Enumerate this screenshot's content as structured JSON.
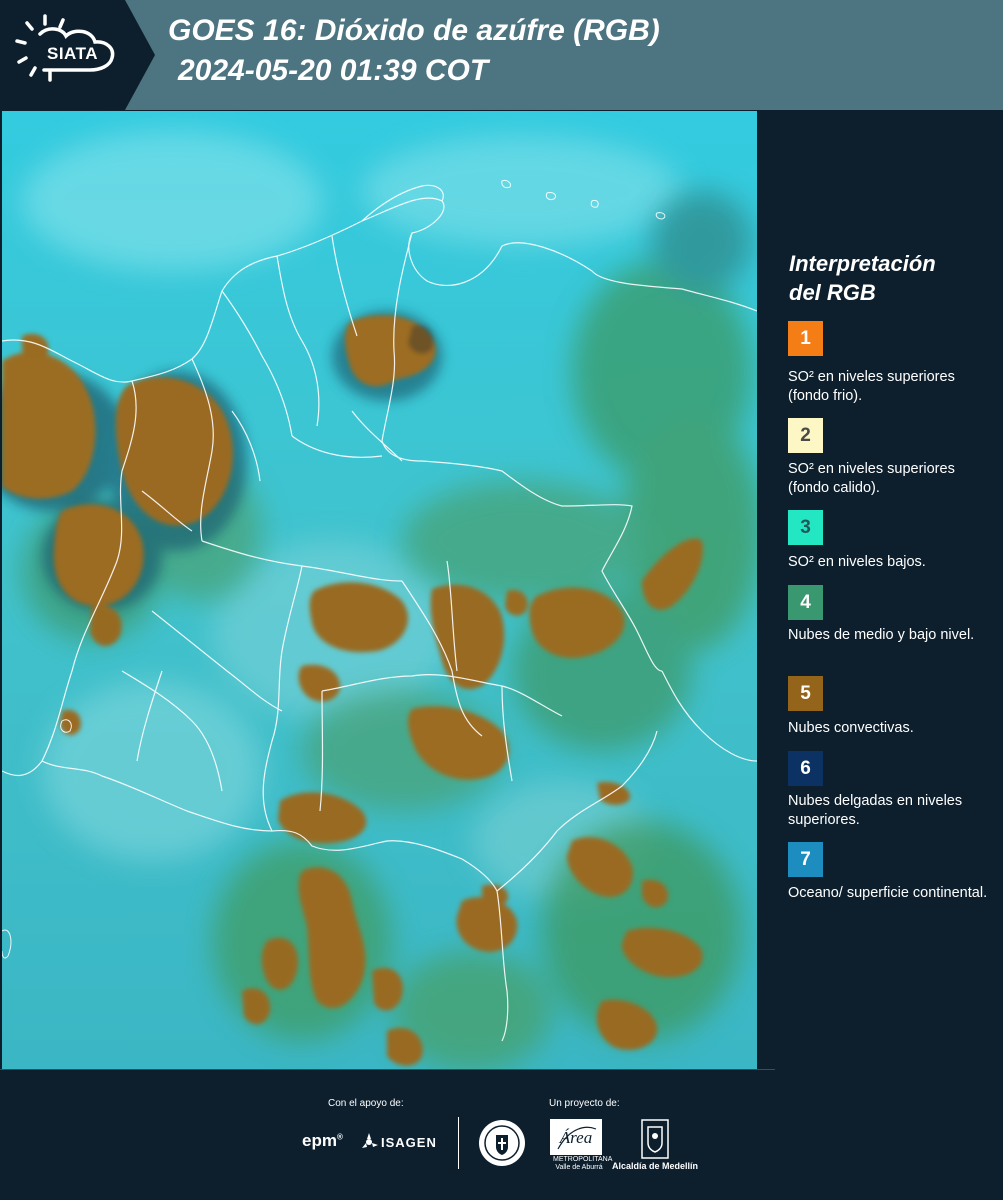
{
  "header": {
    "logo_text": "SIATA",
    "title_line1": "GOES 16: Dióxido de azúfre (RGB)",
    "title_line2": "2024-05-20 01:39 COT"
  },
  "legend": {
    "title_line1": "Interpretación",
    "title_line2": "del RGB",
    "items": [
      {
        "number": "1",
        "color": "#f47d16",
        "text_color": "#ffffff",
        "text": "SO² en niveles superiores (fondo frio)."
      },
      {
        "number": "2",
        "color": "#fdf7c6",
        "text_color": "#4a4a4a",
        "text": "SO² en niveles superiores (fondo calido)."
      },
      {
        "number": "3",
        "color": "#23e6c3",
        "text_color": "#1f5a5a",
        "text": "SO² en niveles bajos."
      },
      {
        "number": "4",
        "color": "#3a9870",
        "text_color": "#ffffff",
        "text": "Nubes de medio y bajo nivel."
      },
      {
        "number": "5",
        "color": "#94641b",
        "text_color": "#ffffff",
        "text": "Nubes convectivas."
      },
      {
        "number": "6",
        "color": "#0c3263",
        "text_color": "#ffffff",
        "text": "Nubes delgadas en niveles superiores."
      },
      {
        "number": "7",
        "color": "#1d8cbf",
        "text_color": "#ffffff",
        "text": "Oceano/ superficie continental."
      }
    ]
  },
  "footer": {
    "support_label": "Con el apoyo de:",
    "project_label": "Un proyecto de:",
    "sponsor1": "epm",
    "sponsor2": "ISAGEN",
    "area_logo_text": "Área",
    "area_sub": "METROPOLITANA Valle de Aburrá",
    "alcaldia": "Alcaldía de Medellín"
  },
  "colors": {
    "background": "#0d1f2d",
    "header_band": "#4d7481",
    "ocean_cyan": "#2bc4d6",
    "convective": "#9a6c22",
    "vegetation": "#3f9a6a"
  }
}
